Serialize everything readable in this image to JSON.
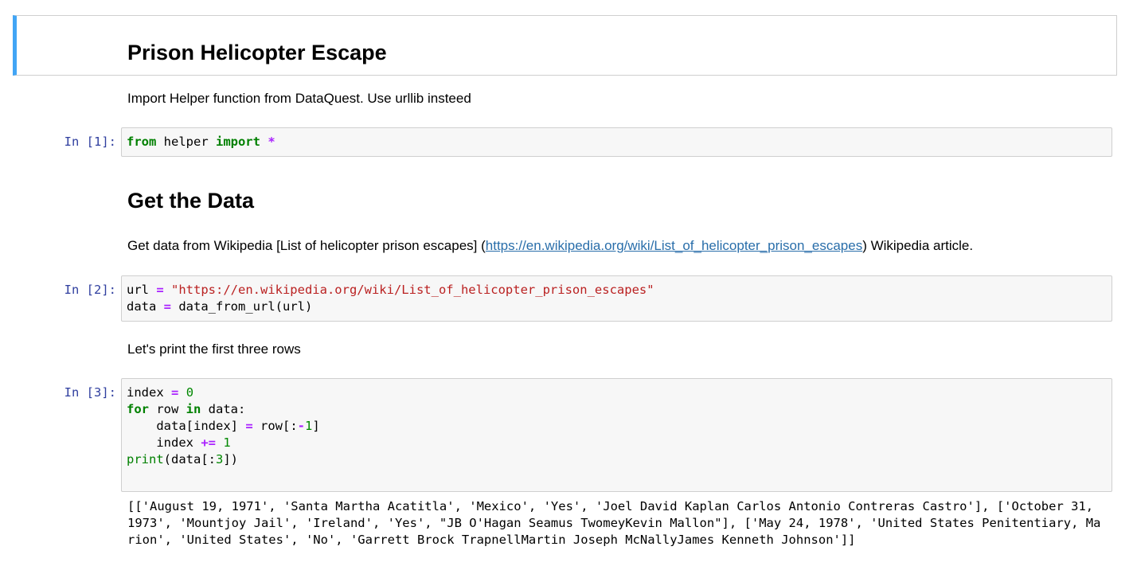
{
  "cells": {
    "title": "Prison Helicopter Escape",
    "intro_text": "Import Helper function from DataQuest. Use urllib insteed",
    "cell1": {
      "prompt": "In [1]:",
      "tokens": {
        "from": "from",
        "module": " helper ",
        "import": "import",
        "star": " *"
      }
    },
    "heading2": "Get the Data",
    "get_data": {
      "before": "Get data from Wikipedia [List of helicopter prison escapes] (",
      "link": "https://en.wikipedia.org/wiki/List_of_helicopter_prison_escapes",
      "after": ") Wikipedia article."
    },
    "cell2": {
      "prompt": "In [2]:",
      "line1_var": "url ",
      "line1_op": "=",
      "line1_str": " \"https://en.wikipedia.org/wiki/List_of_helicopter_prison_escapes\"",
      "line2_var": "data ",
      "line2_op": "=",
      "line2_rest": " data_from_url(url)"
    },
    "print_text": "Let's print the first three rows",
    "cell3": {
      "prompt": "In [3]:"
    },
    "output": "[['August 19, 1971', 'Santa Martha Acatitla', 'Mexico', 'Yes', 'Joel David Kaplan Carlos Antonio Contreras Castro'], ['October 31, 1973', 'Mountjoy Jail', 'Ireland', 'Yes', \"JB O'Hagan Seamus TwomeyKevin Mallon\"], ['May 24, 1978', 'United States Penitentiary, Marion', 'United States', 'No', 'Garrett Brock TrapnellMartin Joseph McNallyJames Kenneth Johnson']]"
  },
  "colors": {
    "selection_bar": "#42a5f5",
    "prompt": "#303f9f",
    "keyword": "#008000",
    "operator": "#aa22ff",
    "string": "#ba2121",
    "link": "#296eaa"
  }
}
